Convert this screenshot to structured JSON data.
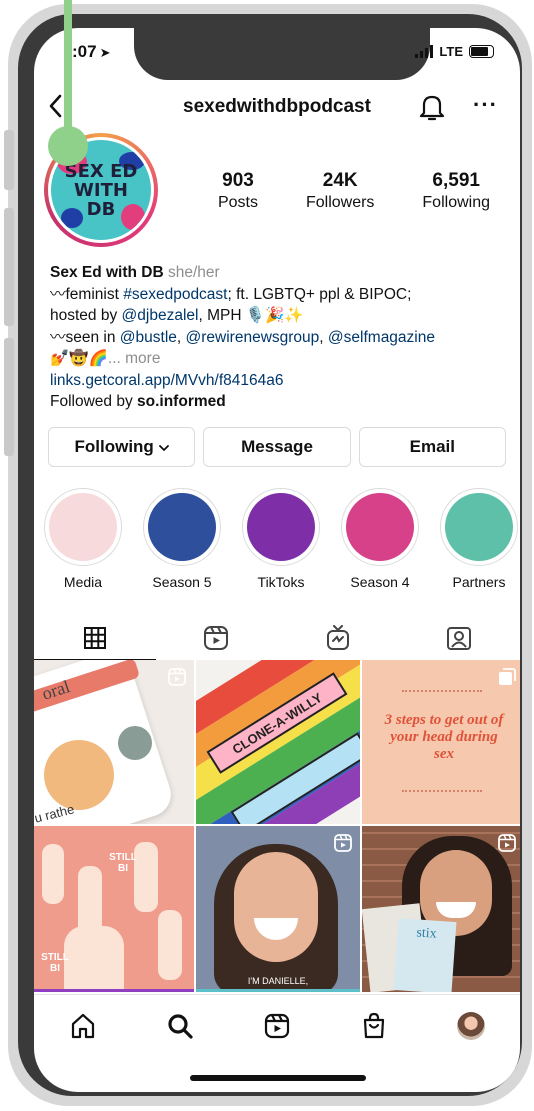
{
  "status_bar": {
    "time": ":07",
    "network": "LTE"
  },
  "header": {
    "username": "sexedwithdbpodcast"
  },
  "profile": {
    "avatar_text_line1": "SEX ED",
    "avatar_text_line2": "WITH",
    "avatar_text_line3": "DB",
    "stats": [
      {
        "value": "903",
        "label": "Posts"
      },
      {
        "value": "24K",
        "label": "Followers"
      },
      {
        "value": "6,591",
        "label": "Following"
      }
    ]
  },
  "bio": {
    "name": "Sex Ed with DB",
    "pronouns": "she/her",
    "line1_prefix": "〰feminist ",
    "line1_hashtag": "#sexedpodcast",
    "line1_suffix": "; ft. LGBTQ+ ppl & BIPOC;",
    "line2_prefix": "hosted by ",
    "line2_mention": "@djbezalel",
    "line2_suffix": ", MPH 🎙️🎉✨",
    "line3_prefix": "〰seen in ",
    "line3_mention1": "@bustle",
    "line3_sep1": ", ",
    "line3_mention2": "@rewirenewsgroup",
    "line3_sep2": ", ",
    "line3_mention3": "@selfmagazine",
    "line4_emoji": "💅🤠🌈",
    "line4_more": "... more",
    "website": "links.getcoral.app/MVvh/f84164a6",
    "followed_prefix": "Followed by ",
    "followed_by": "so.informed"
  },
  "buttons": {
    "following": "Following",
    "message": "Message",
    "email": "Email"
  },
  "highlights": [
    {
      "label": "Media",
      "color": "#f7dadb"
    },
    {
      "label": "Season 5",
      "color": "#2e4f9c"
    },
    {
      "label": "TikToks",
      "color": "#7e2fa8"
    },
    {
      "label": "Season 4",
      "color": "#d64189"
    },
    {
      "label": "Partners",
      "color": "#5fc0a9"
    }
  ],
  "grid": {
    "post1_text": "oral",
    "post1_caption": "u rathe",
    "post2_text": "CLONE-A-WILLY",
    "post3_text": "3 steps to get out of your head during sex",
    "post4_text": "STILL BI",
    "post5_caption": "I'M DANIELLE,",
    "post6_text": "stix"
  },
  "colors": {
    "link": "#00376b",
    "muted": "#8e8e8e",
    "post3_text": "#e0523a",
    "post3_bg": "#f6c8ad",
    "post4_bg": "#ef9c8c"
  }
}
